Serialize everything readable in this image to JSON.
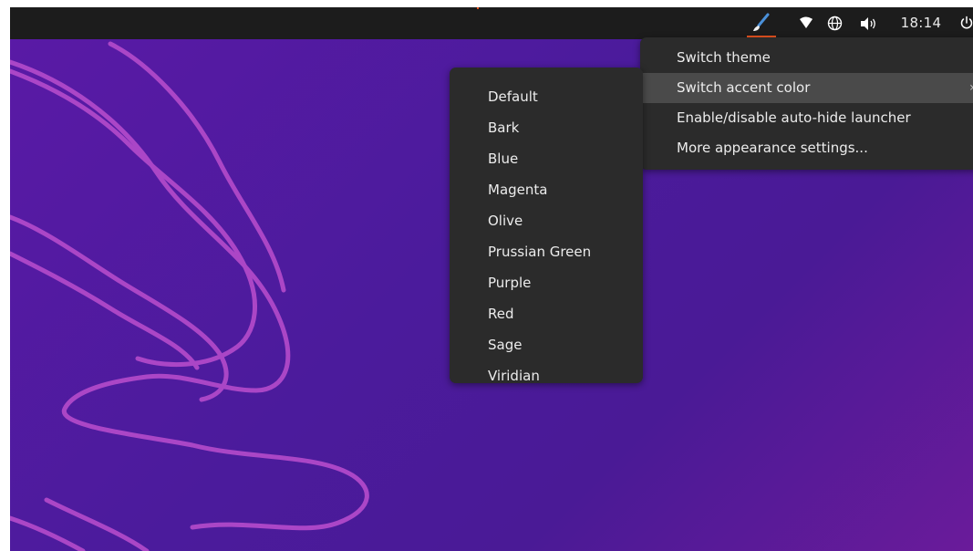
{
  "topbar": {
    "clock": "18:14",
    "icons": {
      "brush": "paintbrush-icon",
      "wifi": "wifi-icon",
      "network": "globe-icon",
      "volume": "volume-icon",
      "power": "power-icon"
    },
    "accent_color": "#e95420"
  },
  "appearance_menu": {
    "items": [
      {
        "label": "Switch theme"
      },
      {
        "label": "Switch accent color",
        "active": true,
        "has_submenu": true
      },
      {
        "label": "Enable/disable auto-hide launcher"
      },
      {
        "label": "More appearance settings..."
      }
    ],
    "submenu_arrow": "›"
  },
  "accent_menu": {
    "items": [
      {
        "label": "Default"
      },
      {
        "label": "Bark"
      },
      {
        "label": "Blue"
      },
      {
        "label": "Magenta"
      },
      {
        "label": "Olive"
      },
      {
        "label": "Prussian Green"
      },
      {
        "label": "Purple"
      },
      {
        "label": "Red"
      },
      {
        "label": "Sage"
      },
      {
        "label": "Viridian"
      }
    ]
  },
  "desktop": {
    "background_color": "#4e1a9c",
    "wallpaper_line_color": "#b049c9"
  }
}
